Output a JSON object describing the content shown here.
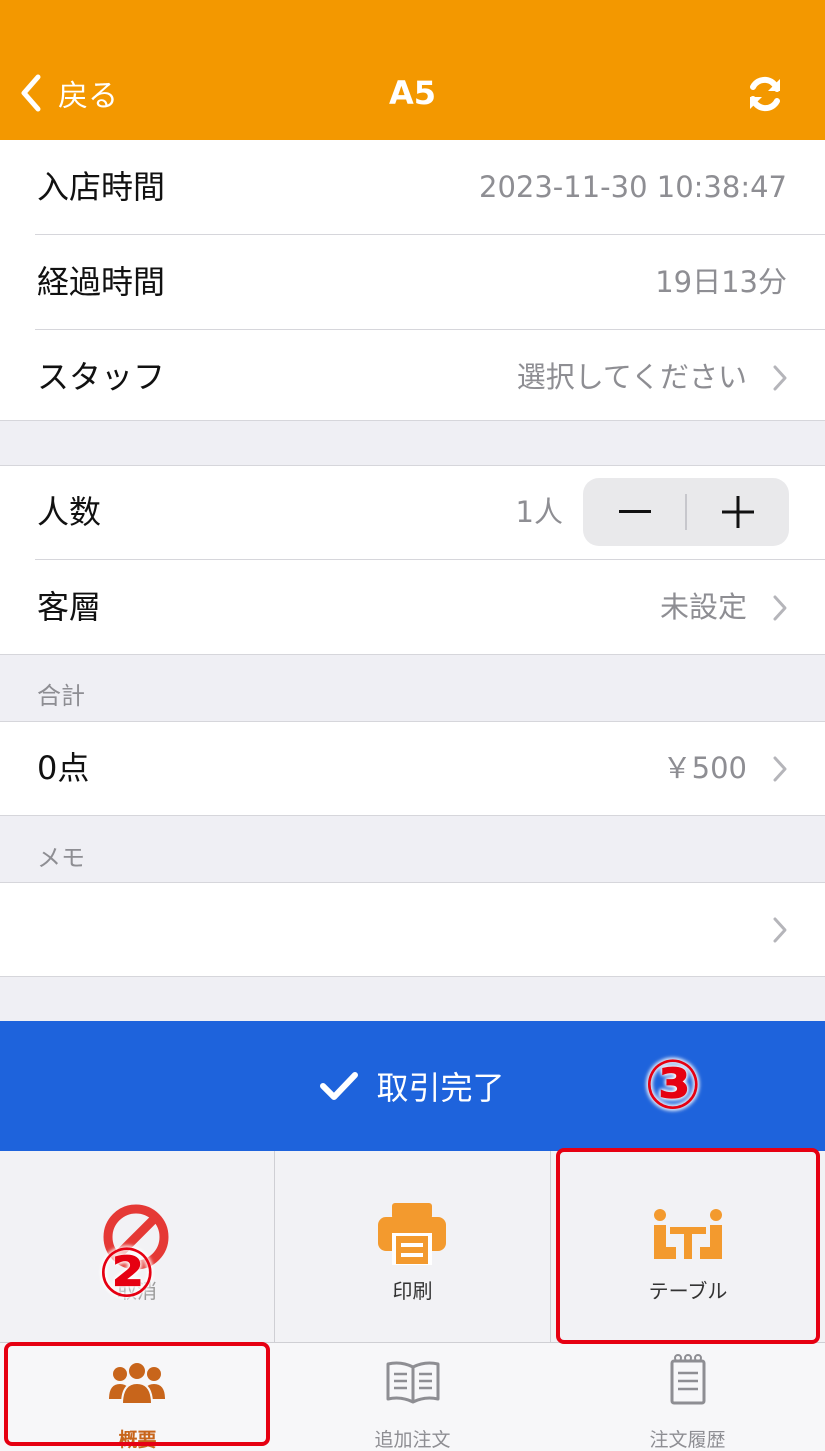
{
  "navbar": {
    "back_label": "戻る",
    "title": "A5",
    "refresh_icon": "refresh-icon",
    "color": "#f39800"
  },
  "info": {
    "entry_time_label": "入店時間",
    "entry_time_value": "2023-11-30 10:38:47",
    "elapsed_label": "経過時間",
    "elapsed_value": "19日13分",
    "staff_label": "スタッフ",
    "staff_value": "選択してください"
  },
  "guests": {
    "people_label": "人数",
    "people_value": "1人",
    "minus": "－",
    "plus": "＋",
    "customer_type_label": "客層",
    "customer_type_value": "未設定"
  },
  "total": {
    "header": "合計",
    "items_label": "0点",
    "amount": "￥500"
  },
  "memo": {
    "header": "メモ",
    "value": ""
  },
  "complete_button": {
    "label": "取引完了",
    "color": "#1e63dc"
  },
  "actions": [
    {
      "label": "取消",
      "icon": "cancel-icon",
      "color": "#e53935"
    },
    {
      "label": "印刷",
      "icon": "printer-icon",
      "color": "#f39a2e"
    },
    {
      "label": "テーブル",
      "icon": "table-icon",
      "color": "#f39a2e"
    }
  ],
  "tabs": [
    {
      "label": "概要",
      "icon": "people-icon",
      "active": true
    },
    {
      "label": "追加注文",
      "icon": "book-icon",
      "active": false
    },
    {
      "label": "注文履歴",
      "icon": "receipt-icon",
      "active": false
    }
  ],
  "annotations": {
    "marker_2": "②",
    "marker_3": "③",
    "color": "#e60012"
  }
}
